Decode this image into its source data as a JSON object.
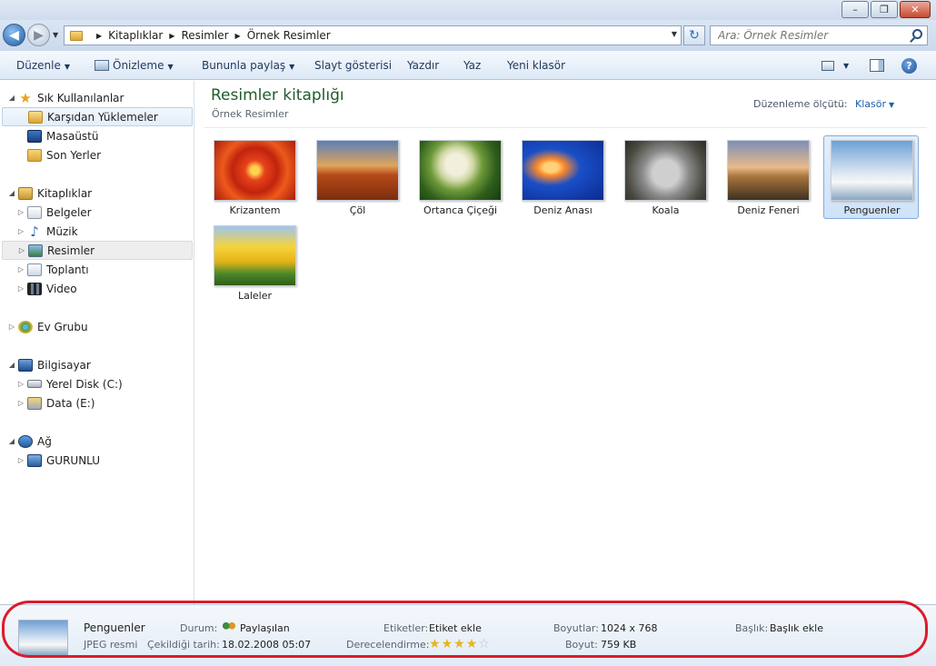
{
  "window": {
    "minimize": "–",
    "maximize": "❐",
    "close": "✕"
  },
  "address": {
    "crumbs": [
      "Kitaplıklar",
      "Resimler",
      "Örnek Resimler"
    ],
    "search_placeholder": "Ara: Örnek Resimler"
  },
  "toolbar": {
    "organize": "Düzenle",
    "preview": "Önizleme",
    "share": "Bununla paylaş",
    "slideshow": "Slayt gösterisi",
    "print": "Yazdır",
    "burn": "Yaz",
    "new_folder": "Yeni klasör",
    "help": "?"
  },
  "nav": {
    "favorites": "Sık Kullanılanlar",
    "downloads": "Karşıdan Yüklemeler",
    "desktop": "Masaüstü",
    "recent": "Son Yerler",
    "libraries": "Kitaplıklar",
    "documents": "Belgeler",
    "music": "Müzik",
    "pictures": "Resimler",
    "meeting": "Toplantı",
    "video": "Video",
    "homegroup": "Ev Grubu",
    "computer": "Bilgisayar",
    "drive_c": "Yerel Disk (C:)",
    "drive_e": "Data (E:)",
    "network": "Ağ",
    "network_pc": "GURUNLU"
  },
  "library": {
    "title": "Resimler kitaplığı",
    "subtitle": "Örnek Resimler",
    "arrange_label": "Düzenleme ölçütü:",
    "arrange_value": "Klasör"
  },
  "files": [
    {
      "label": "Krizantem"
    },
    {
      "label": "Çöl"
    },
    {
      "label": "Ortanca Çiçeği"
    },
    {
      "label": "Deniz Anası"
    },
    {
      "label": "Koala"
    },
    {
      "label": "Deniz Feneri"
    },
    {
      "label": "Penguenler"
    },
    {
      "label": "Laleler"
    }
  ],
  "details": {
    "name": "Penguenler",
    "type": "JPEG resmi",
    "state_label": "Durum:",
    "state_value": "Paylaşılan",
    "date_label": "Çekildiği tarih:",
    "date_value": "18.02.2008 05:07",
    "tags_label": "Etiketler:",
    "tags_value": "Etiket ekle",
    "rating_label": "Derecelendirme:",
    "rating": 4,
    "rating_max": 5,
    "dimensions_label": "Boyutlar:",
    "dimensions_value": "1024 x 768",
    "size_label": "Boyut:",
    "size_value": "759 KB",
    "title_label": "Başlık:",
    "title_value": "Başlık ekle"
  },
  "colors": {
    "library_title": "#1e5c2a",
    "link_blue": "#1f5fa8",
    "annotation": "#dc1b2b",
    "selection": "#cfe2f8"
  }
}
